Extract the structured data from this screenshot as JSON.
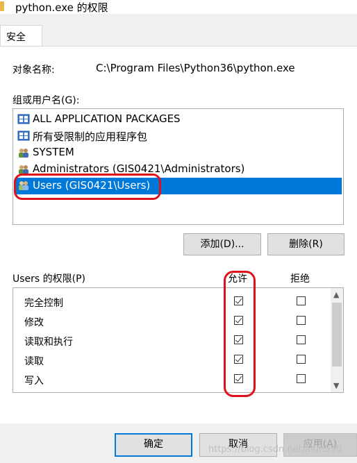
{
  "window": {
    "title": "python.exe 的权限"
  },
  "tabs": [
    {
      "label": "安全"
    }
  ],
  "object": {
    "label": "对象名称:",
    "value": "C:\\Program Files\\Python36\\python.exe"
  },
  "groups": {
    "label": "组或用户名(G):",
    "items": [
      {
        "name": "ALL APPLICATION PACKAGES",
        "icon": "app-packages-icon"
      },
      {
        "name": "所有受限制的应用程序包",
        "icon": "app-packages-icon"
      },
      {
        "name": "SYSTEM",
        "icon": "users-group-icon"
      },
      {
        "name": "Administrators (GIS0421\\Administrators)",
        "icon": "users-group-icon"
      },
      {
        "name": "Users (GIS0421\\Users)",
        "icon": "users-group-icon",
        "selected": true
      }
    ]
  },
  "buttons": {
    "add": "添加(D)...",
    "remove": "删除(R)",
    "ok": "确定",
    "cancel": "取消",
    "apply": "应用(A)"
  },
  "permissions": {
    "label": "Users 的权限(P)",
    "allow_header": "允许",
    "deny_header": "拒绝",
    "rows": [
      {
        "name": "完全控制",
        "allow": true,
        "deny": false
      },
      {
        "name": "修改",
        "allow": true,
        "deny": false
      },
      {
        "name": "读取和执行",
        "allow": true,
        "deny": false
      },
      {
        "name": "读取",
        "allow": true,
        "deny": false
      },
      {
        "name": "写入",
        "allow": true,
        "deny": false
      }
    ]
  },
  "watermark": "https://blog.csdn.net/alun550",
  "colors": {
    "selection": "#0078d7",
    "annotation": "#e0101a"
  }
}
